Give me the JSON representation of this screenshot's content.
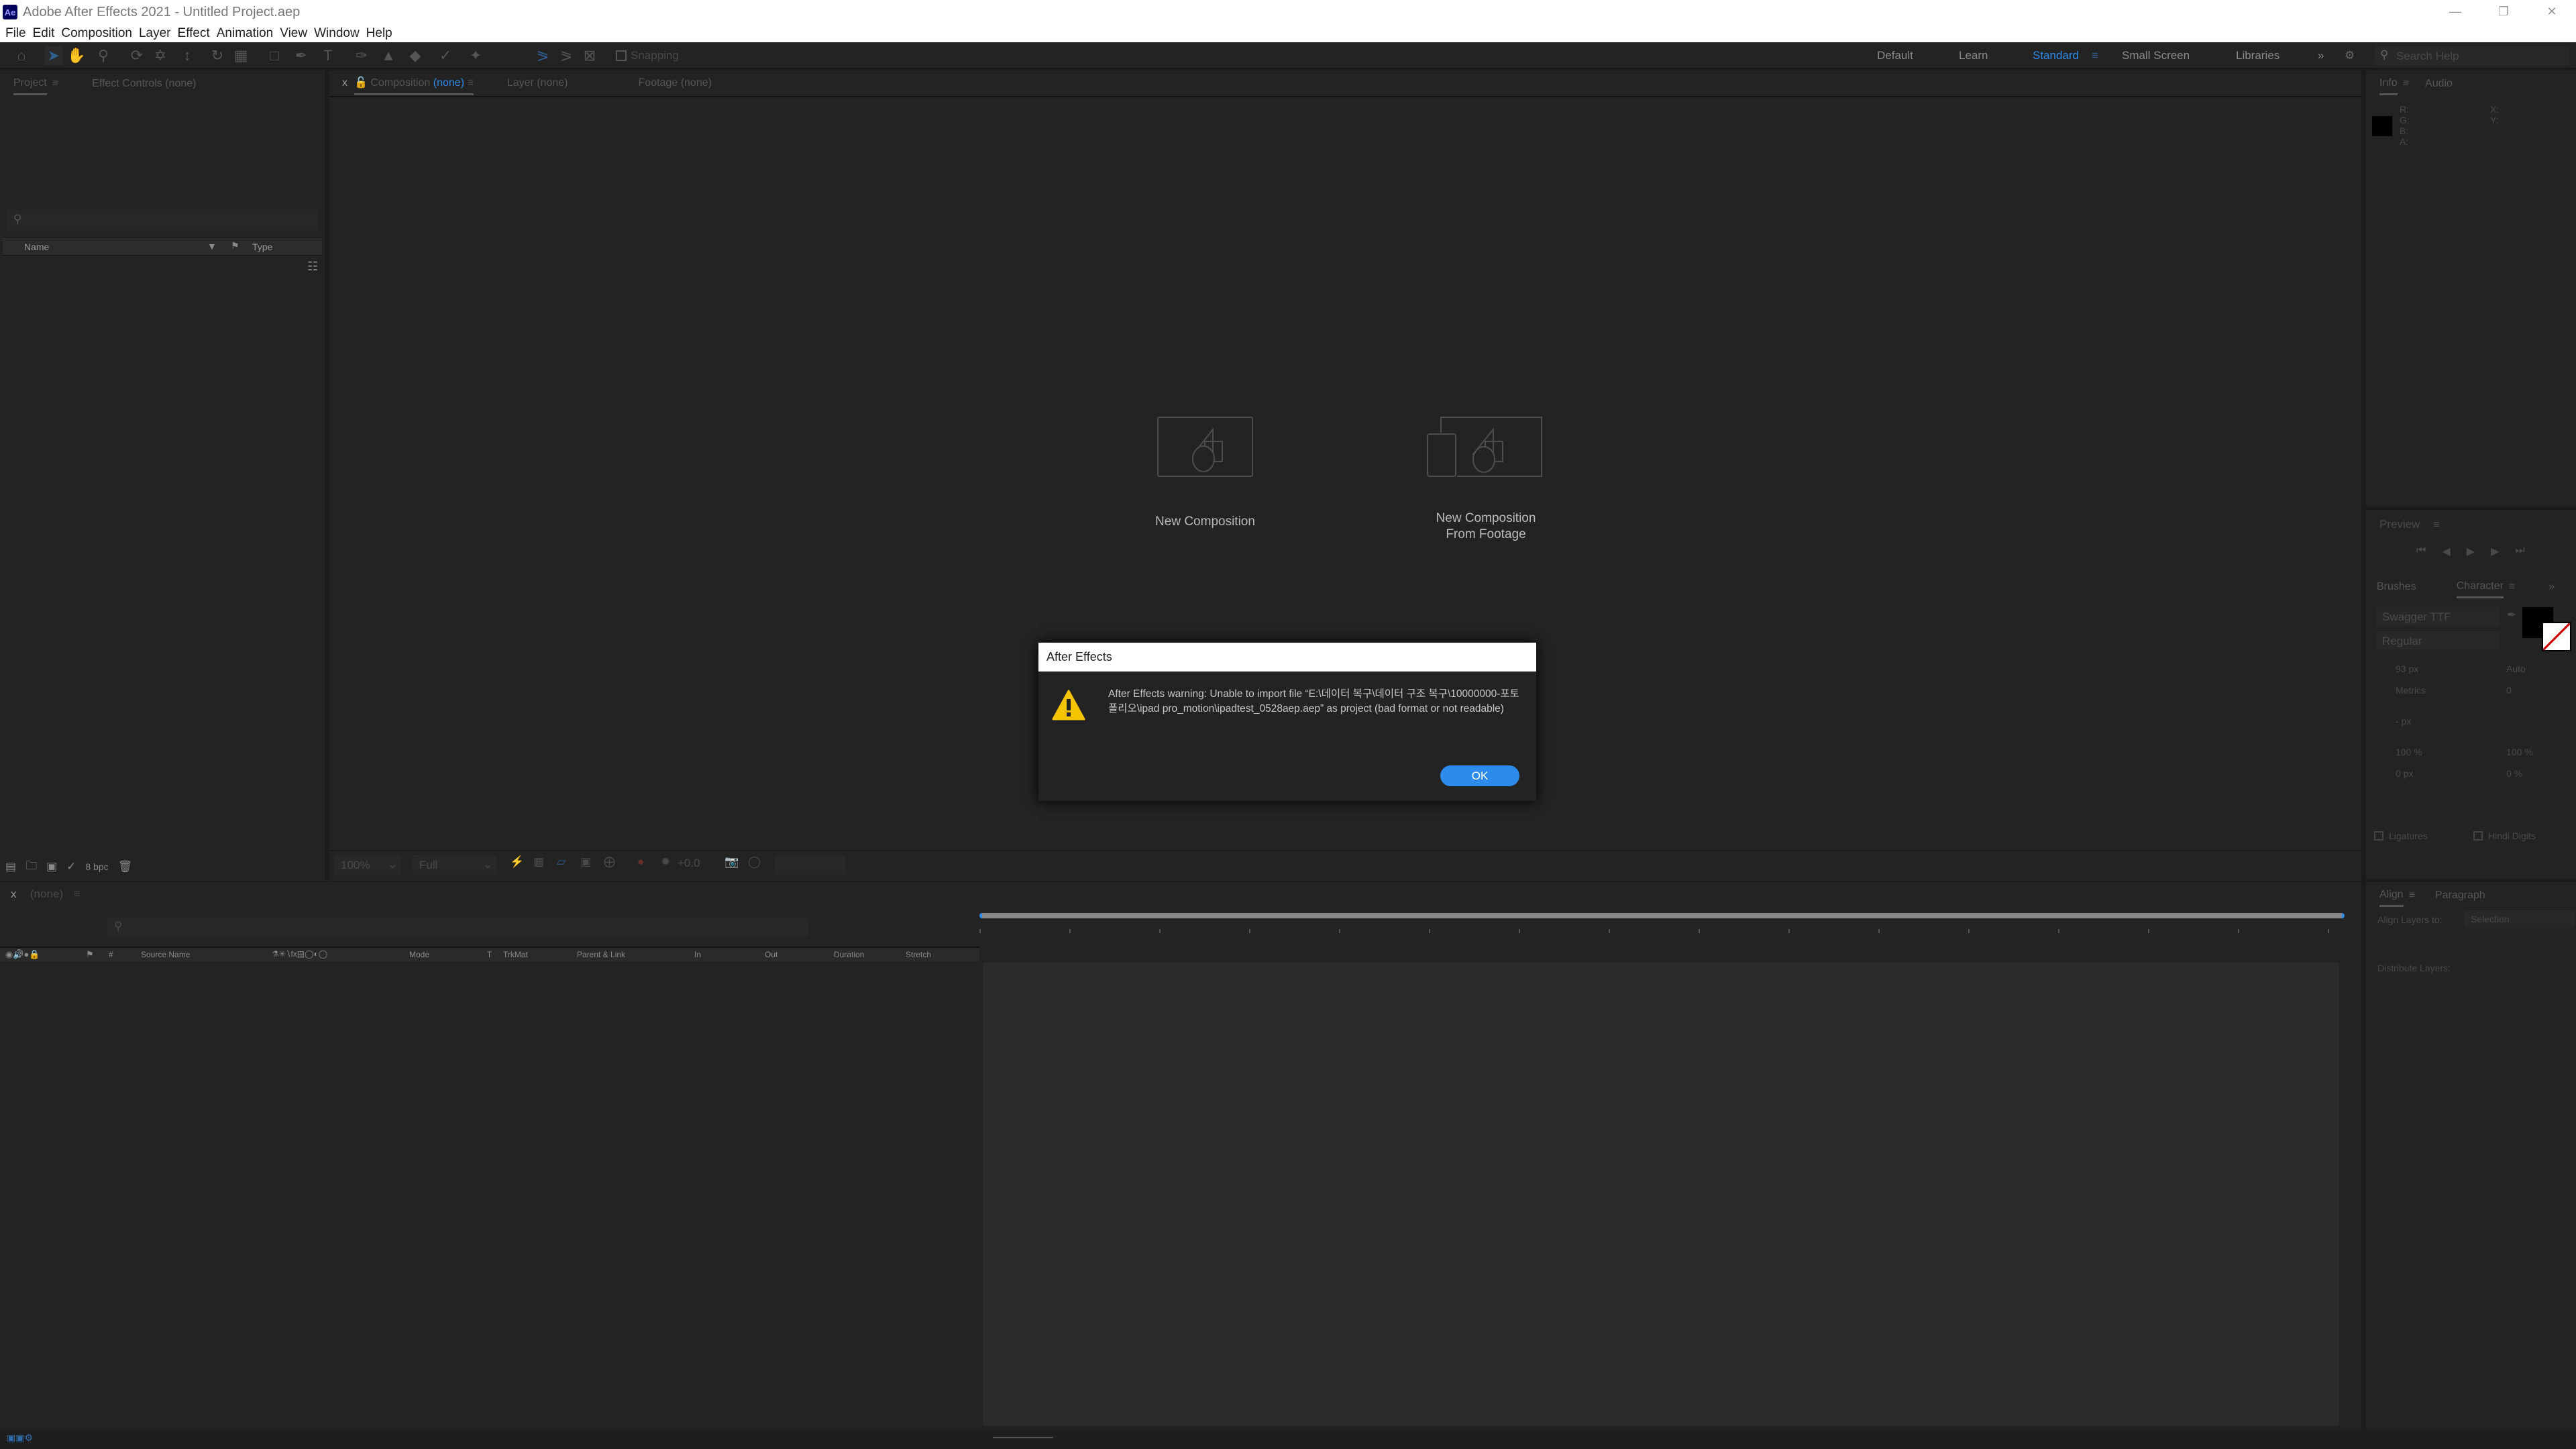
{
  "window": {
    "title": "Adobe After Effects 2021 - Untitled Project.aep",
    "logo": "Ae",
    "controls": [
      "minimize-icon",
      "restore-icon",
      "close-icon"
    ]
  },
  "menu": [
    "File",
    "Edit",
    "Composition",
    "Layer",
    "Effect",
    "Animation",
    "View",
    "Window",
    "Help"
  ],
  "toolbar": {
    "snapping": "Snapping",
    "workspaces": [
      "Default",
      "Learn",
      "Standard",
      "Small Screen",
      "Libraries"
    ],
    "active_workspace": "Standard",
    "search_placeholder": "Search Help",
    "accent": "#2d8ceb"
  },
  "project_panel": {
    "tabs": [
      "Project",
      "Effect Controls (none)"
    ],
    "columns": [
      "Name",
      "Type"
    ],
    "bpc": "8 bpc"
  },
  "comp_panel": {
    "tabs": {
      "composition": "Composition",
      "composition_value": "(none)",
      "layer": "Layer (none)",
      "footage": "Footage (none)"
    },
    "new_comp": "New Composition",
    "new_comp_footage_1": "New Composition",
    "new_comp_footage_2": "From Footage",
    "zoom": "100%",
    "resolution": "Full",
    "exposure": "+0.0"
  },
  "info_panel": {
    "tabs": [
      "Info",
      "Audio"
    ],
    "labels": [
      "R:",
      "G:",
      "B:",
      "A:",
      "X:",
      "Y:"
    ]
  },
  "preview_panel": {
    "title": "Preview"
  },
  "character_panel": {
    "tabs": [
      "Brushes",
      "Character"
    ],
    "font": "Swagger TTF",
    "style": "Regular",
    "size": "93 px",
    "leading": "Auto",
    "kerning": "Metrics",
    "tracking": "0",
    "stroke": "- px",
    "vscale": "100 %",
    "hscale": "100 %",
    "baseline": "0 px",
    "tsume": "0 %",
    "ligatures": "Ligatures",
    "hindi": "Hindi Digits"
  },
  "align_panel": {
    "tabs": [
      "Align",
      "Paragraph"
    ],
    "align_to_label": "Align Layers to:",
    "align_to": "Selection",
    "distribute": "Distribute Layers:"
  },
  "timeline": {
    "tab": "(none)",
    "columns": [
      "#",
      "Source Name",
      "Mode",
      "T",
      "TrkMat",
      "Parent & Link",
      "In",
      "Out",
      "Duration",
      "Stretch"
    ]
  },
  "dialog": {
    "title": "After Effects",
    "message": "After Effects warning: Unable to import file “E:\\데이터 복구\\데이터 구조 복구\\10000000-포토폴리오\\ipad pro_motion\\ipadtest_0528aep.aep” as project (bad format or not readable)",
    "ok": "OK",
    "icon": "warning-icon"
  }
}
